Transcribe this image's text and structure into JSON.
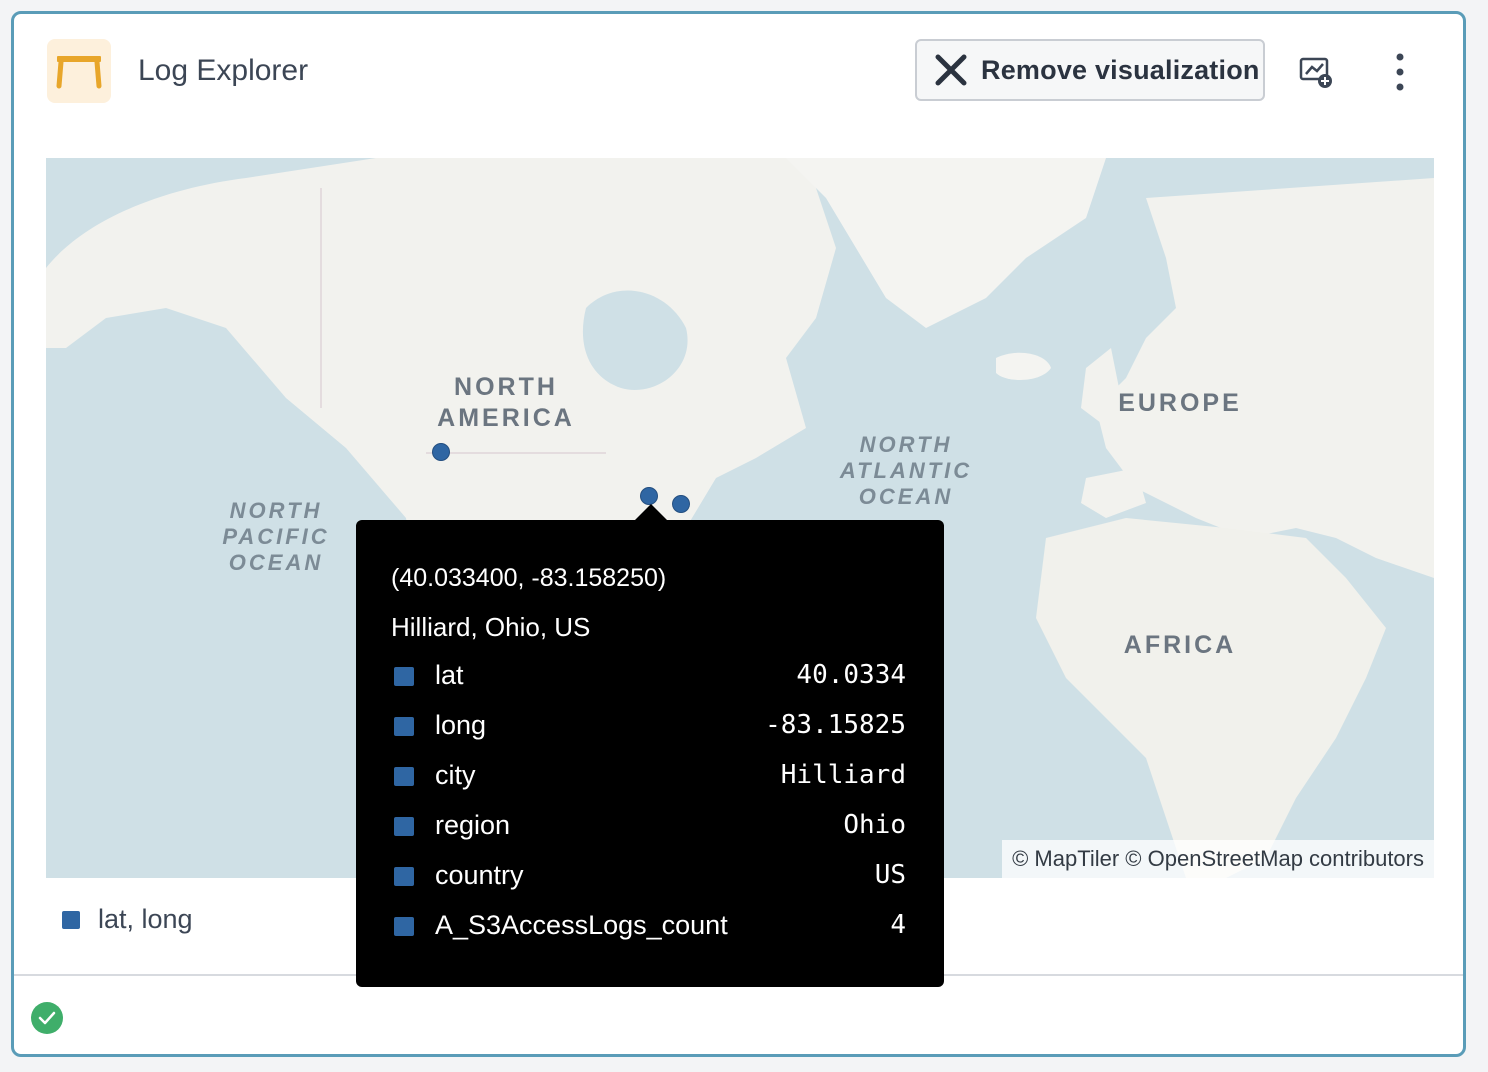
{
  "header": {
    "title": "Log Explorer",
    "app_icon": "table-icon",
    "remove_button_label": "Remove visualization",
    "add_icon": "add-chart-icon",
    "more_icon": "more-vertical-icon"
  },
  "map": {
    "labels": {
      "north_america_1": "NORTH",
      "north_america_2": "AMERICA",
      "europe": "EUROPE",
      "africa": "AFRICA",
      "npo_1": "NORTH",
      "npo_2": "PACIFIC",
      "npo_3": "OCEAN",
      "nao_1": "NORTH",
      "nao_2": "ATLANTIC",
      "nao_3": "OCEAN"
    },
    "attribution": "© MapTiler © OpenStreetMap contributors",
    "markers": [
      {
        "lat": 45.6,
        "long": -121.2
      },
      {
        "lat": 40.0334,
        "long": -83.15825
      },
      {
        "lat": 39.0,
        "long": -77.5
      }
    ]
  },
  "legend": {
    "label": "lat, long"
  },
  "tooltip": {
    "coords": "(40.033400, -83.158250)",
    "place": "Hilliard, Ohio, US",
    "rows": [
      {
        "key": "lat",
        "value": "40.0334"
      },
      {
        "key": "long",
        "value": "-83.15825"
      },
      {
        "key": "city",
        "value": "Hilliard"
      },
      {
        "key": "region",
        "value": "Ohio"
      },
      {
        "key": "country",
        "value": "US"
      },
      {
        "key": "A_S3AccessLogs_count",
        "value": "4"
      }
    ]
  },
  "colors": {
    "accent": "#2f66a3",
    "panel_border": "#5a9cb8",
    "status_ok": "#3fae6a",
    "app_icon": "#e8a62a"
  },
  "status": {
    "icon": "check-circle-icon"
  }
}
